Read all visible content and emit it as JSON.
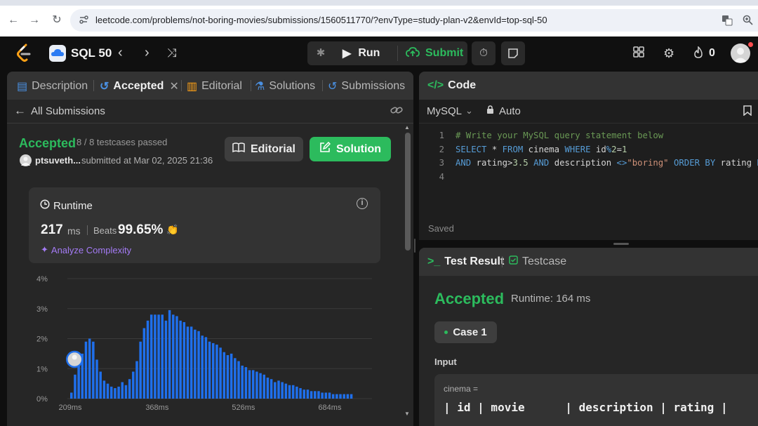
{
  "browser": {
    "url": "leetcode.com/problems/not-boring-movies/submissions/1560511770/?envType=study-plan-v2&envId=top-sql-50"
  },
  "topbar": {
    "study_plan_title": "SQL 50",
    "run_label": "Run",
    "submit_label": "Submit",
    "fire_count": "0"
  },
  "left_tabs": {
    "description": "Description",
    "accepted": "Accepted",
    "editorial": "Editorial",
    "solutions": "Solutions",
    "submissions": "Submissions"
  },
  "submission": {
    "back_label": "All Submissions",
    "status": "Accepted",
    "testcases": "8 / 8 testcases passed",
    "user": "ptsuveth...",
    "submitted_at": "submitted at Mar 02, 2025 21:36",
    "editorial_button": "Editorial",
    "solution_button": "Solution"
  },
  "runtime_card": {
    "title": "Runtime",
    "value": "217",
    "unit": "ms",
    "beats_label": "Beats",
    "beats_pct": "99.65%",
    "analyze_label": "Analyze Complexity"
  },
  "chart_data": {
    "type": "bar",
    "yticks": [
      "4%",
      "3%",
      "2%",
      "1%",
      "0%"
    ],
    "ylim": [
      0,
      4
    ],
    "xticks": [
      "209ms",
      "368ms",
      "526ms",
      "684ms"
    ],
    "xtick_values": [
      209,
      368,
      526,
      684
    ],
    "bin_start": 209,
    "bin_step": 6.65,
    "user_marker_ms": 217,
    "bar_color": "#1f6feb",
    "values": [
      0.2,
      0.8,
      1.1,
      1.5,
      1.9,
      2.0,
      1.9,
      1.3,
      0.9,
      0.6,
      0.5,
      0.4,
      0.35,
      0.4,
      0.55,
      0.45,
      0.65,
      0.9,
      1.25,
      1.9,
      2.35,
      2.6,
      2.8,
      2.8,
      2.8,
      2.8,
      2.6,
      2.95,
      2.8,
      2.75,
      2.6,
      2.55,
      2.4,
      2.4,
      2.3,
      2.25,
      2.1,
      2.05,
      1.9,
      1.85,
      1.8,
      1.7,
      1.55,
      1.45,
      1.5,
      1.35,
      1.25,
      1.1,
      1.05,
      0.95,
      0.95,
      0.9,
      0.85,
      0.8,
      0.7,
      0.65,
      0.55,
      0.6,
      0.55,
      0.5,
      0.45,
      0.45,
      0.4,
      0.35,
      0.3,
      0.3,
      0.25,
      0.25,
      0.25,
      0.2,
      0.2,
      0.2,
      0.15,
      0.15,
      0.15,
      0.15,
      0.15,
      0.15
    ]
  },
  "code_panel": {
    "title": "Code",
    "language": "MySQL",
    "mode": "Auto",
    "saved_label": "Saved",
    "line_numbers": [
      "1",
      "2",
      "3",
      "4"
    ]
  },
  "test_result": {
    "title": "Test Result",
    "testcase_tab": "Testcase",
    "status": "Accepted",
    "runtime": "Runtime: 164 ms",
    "case_label": "Case 1",
    "input_label": "Input",
    "input_var": "cinema =",
    "input_table_header": "| id | movie      | description | rating |"
  },
  "colors": {
    "accent_green": "#2cbb5d",
    "bg": "#0f0f0f",
    "panel": "#262626"
  }
}
